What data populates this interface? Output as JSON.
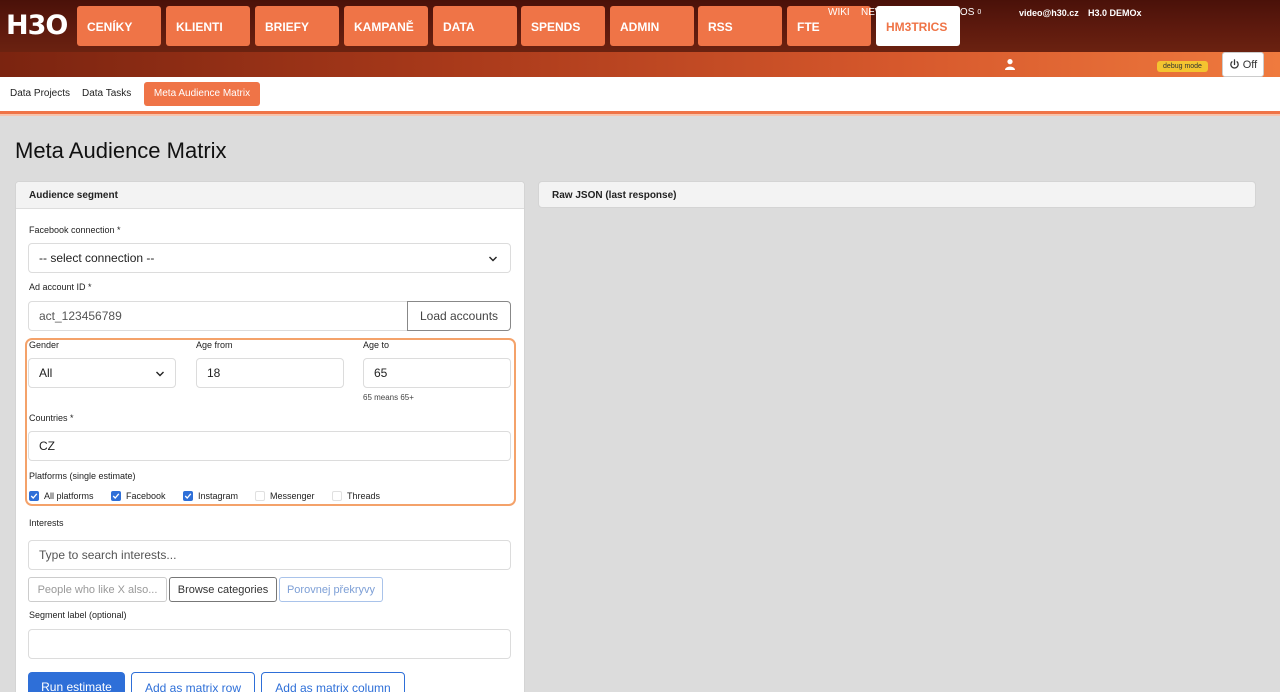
{
  "app": {
    "logo": "H3O"
  },
  "nav": {
    "tabs": [
      {
        "label": "CENÍKY",
        "active": false
      },
      {
        "label": "KLIENTI",
        "active": false
      },
      {
        "label": "BRIEFY",
        "active": false
      },
      {
        "label": "KAMPANĚ",
        "active": false
      },
      {
        "label": "DATA",
        "active": false
      },
      {
        "label": "SPENDS",
        "active": false
      },
      {
        "label": "ADMIN",
        "active": false
      },
      {
        "label": "RSS",
        "active": false
      },
      {
        "label": "FTE",
        "active": false
      },
      {
        "label": "HM3TRICS",
        "active": true
      }
    ]
  },
  "util": {
    "wiki": "WIKI",
    "newsletter": "NEWSLETTER",
    "todos": "TODOS",
    "todos_count": "0",
    "user_email": "video@h30.cz",
    "tenant": "H3.0 DEMOx",
    "debug_badge": "debug mode",
    "off_label": "Off"
  },
  "subtabs": {
    "data_projects": "Data Projects",
    "data_tasks": "Data Tasks",
    "active": "Meta Audience Matrix"
  },
  "page": {
    "title": "Meta Audience Matrix"
  },
  "segment": {
    "header": "Audience segment",
    "fb_connection_label": "Facebook connection *",
    "fb_connection_value": "-- select connection --",
    "ad_account_label": "Ad account ID *",
    "ad_account_placeholder": "act_123456789",
    "load_accounts": "Load accounts",
    "gender_label": "Gender",
    "gender_value": "All",
    "age_from_label": "Age from",
    "age_from_value": "18",
    "age_to_label": "Age to",
    "age_to_value": "65",
    "age_hint": "65 means 65+",
    "countries_label": "Countries *",
    "countries_value": "CZ",
    "platforms_label": "Platforms (single estimate)",
    "platforms": [
      {
        "label": "All platforms",
        "checked": true
      },
      {
        "label": "Facebook",
        "checked": true
      },
      {
        "label": "Instagram",
        "checked": true
      },
      {
        "label": "Messenger",
        "checked": false
      },
      {
        "label": "Threads",
        "checked": false
      }
    ],
    "interests_label": "Interests",
    "interests_placeholder": "Type to search interests...",
    "people_like_placeholder": "People who like X also...",
    "browse_categories": "Browse categories",
    "compare_overlaps": "Porovnej překryvy",
    "segment_label_label": "Segment label (optional)",
    "segment_label_value": "",
    "run_estimate": "Run estimate",
    "add_row": "Add as matrix row",
    "add_column": "Add as matrix column"
  },
  "raw": {
    "header": "Raw JSON (last response)"
  },
  "colors": {
    "accent": "#ef7447",
    "primary": "#2e6fd8"
  }
}
